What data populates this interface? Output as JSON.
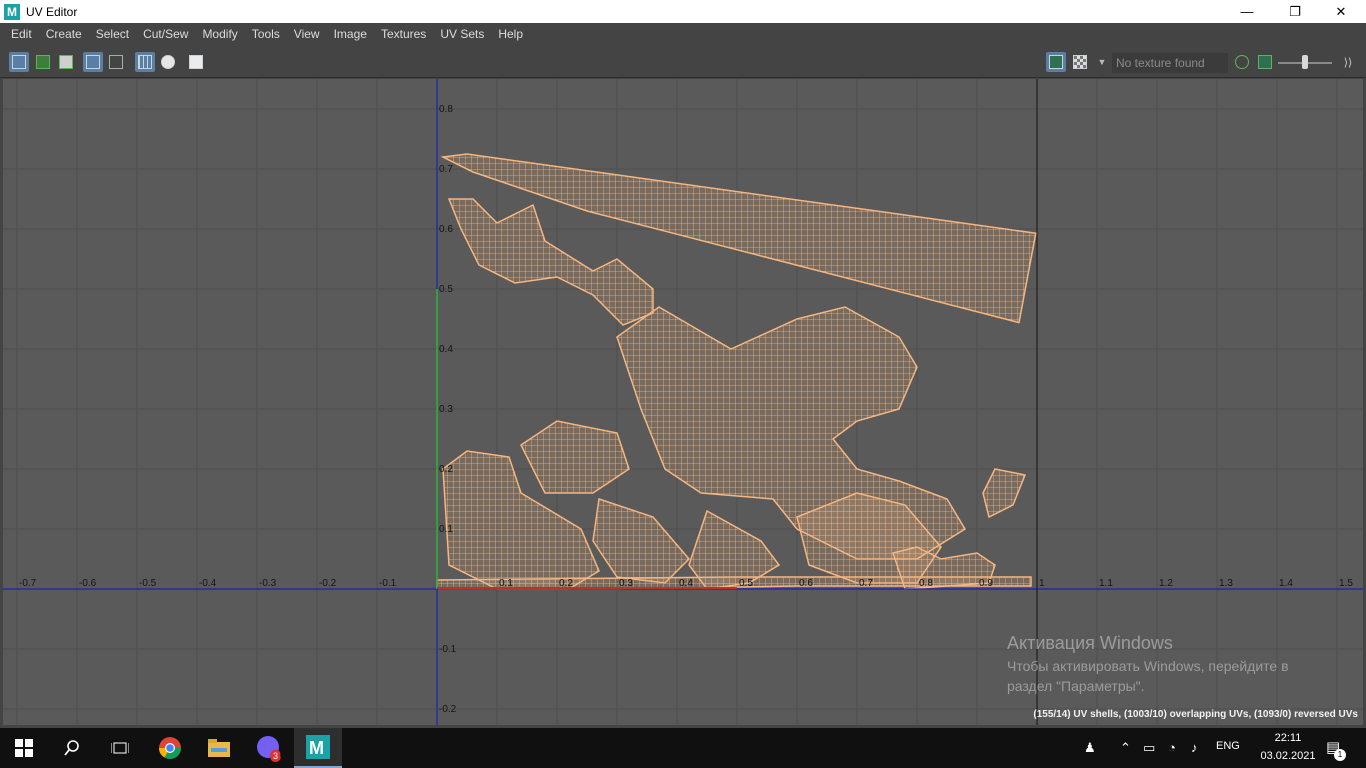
{
  "window": {
    "title": "UV Editor",
    "app_letter": "M",
    "minimize": "—",
    "maximize": "❐",
    "close": "✕"
  },
  "menu": [
    "Edit",
    "Create",
    "Select",
    "Cut/Sew",
    "Modify",
    "Tools",
    "View",
    "Image",
    "Textures",
    "UV Sets",
    "Help"
  ],
  "toolbar": {
    "texture_placeholder": "No texture found",
    "slider_value": 0.55
  },
  "viewport": {
    "x_ticks": [
      "-0.7",
      "-0.6",
      "-0.5",
      "-0.4",
      "-0.3",
      "-0.2",
      "-0.1",
      "0.1",
      "0.2",
      "0.3",
      "0.4",
      "0.5",
      "0.6",
      "0.7",
      "0.8",
      "0.9",
      "1",
      "1.1",
      "1.2",
      "1.3",
      "1.4",
      "1.5"
    ],
    "y_ticks": [
      "0.8",
      "0.7",
      "0.6",
      "0.5",
      "0.4",
      "0.3",
      "0.2",
      "0.1",
      "-0.1",
      "-0.2"
    ],
    "colors": {
      "background": "#5a5a5a",
      "grid": "#4f4f4f",
      "uv_mesh": "#f5b681",
      "axis_u": "#1d1dc4",
      "axis_v_green": "#2dbb2d",
      "u_highlight": "#c0302a",
      "border_line": "#111111"
    }
  },
  "status_bar": {
    "text": "(155/14) UV shells, (1003/10) overlapping UVs, (1093/0) reversed UVs"
  },
  "watermark": {
    "title": "Активация Windows",
    "line1": "Чтобы активировать Windows, перейдите в",
    "line2": "раздел \"Параметры\"."
  },
  "taskbar": {
    "icons": [
      "windows-start-icon",
      "search-icon",
      "task-view-icon",
      "chrome-icon",
      "file-explorer-icon",
      "viber-icon",
      "maya-icon"
    ],
    "viber_badge": "3",
    "language": "ENG",
    "time": "22:11",
    "date": "03.02.2021",
    "notification_count": "1"
  }
}
